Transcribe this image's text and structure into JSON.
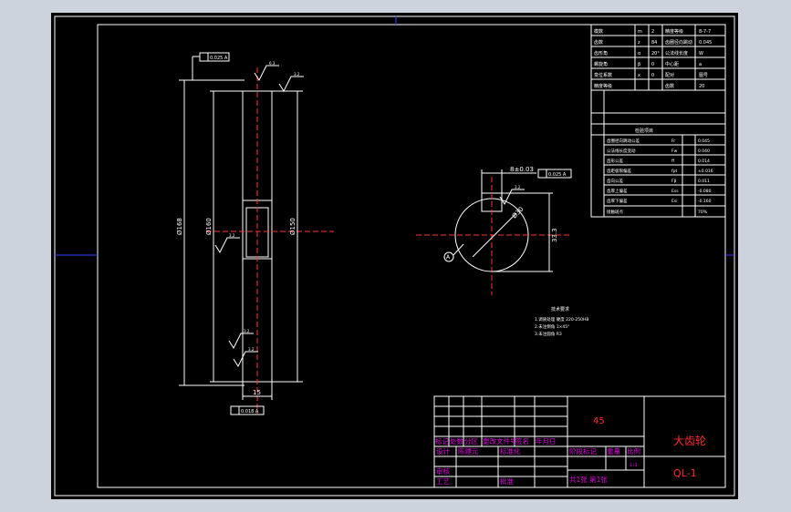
{
  "drawing": {
    "part_name": "大齿轮",
    "drawing_no": "QL-1",
    "material": "45",
    "scale": "1:1"
  },
  "front_view": {
    "dim_outer": "Ø168",
    "dim_middle": "Ø160",
    "dim_inner": "Ø150",
    "dim_width": "15",
    "tol_top": "0.025 A",
    "tol_bottom": "0.018 A",
    "rough_top": "6.3",
    "rough_2": "3.2",
    "rough_3": "3.2",
    "rough_4": "3.2",
    "rough_5": "3.2"
  },
  "side_view": {
    "dim_keyway": "8±0.03",
    "tol_keyway": "0.025 A",
    "dim_bore": "Ø30",
    "dim_depth": "33.3",
    "datum": "A",
    "rough_key": "3.2"
  },
  "params_table": {
    "rows": [
      [
        "模数",
        "m",
        "2",
        "精度等级",
        "8-7-7"
      ],
      [
        "齿数",
        "z",
        "84",
        "齿圈径向跳动",
        "0.045"
      ],
      [
        "齿形角",
        "α",
        "20°",
        "公法线长度",
        "W"
      ],
      [
        "螺旋角",
        "β",
        "0",
        "中心距",
        "a"
      ],
      [
        "变位系数",
        "x",
        "0",
        "配对",
        "图号"
      ],
      [
        "精度等级",
        "",
        "",
        "齿数",
        "20"
      ]
    ]
  },
  "inspection_table": {
    "header": "检验项目",
    "rows": [
      [
        "齿圈径向跳动公差",
        "Fr",
        "0.045"
      ],
      [
        "公法线长度变动",
        "Fw",
        "0.040"
      ],
      [
        "齿形公差",
        "ff",
        "0.014"
      ],
      [
        "齿距极限偏差",
        "fpt",
        "±0.016"
      ],
      [
        "齿向公差",
        "Fβ",
        "0.011"
      ],
      [
        "齿厚上偏差",
        "Ess",
        "-0.080"
      ],
      [
        "齿厚下偏差",
        "Esi",
        "-0.160"
      ],
      [
        "接触斑点",
        "",
        "70%"
      ]
    ]
  },
  "tech_requirements": {
    "title": "技术要求",
    "items": [
      "1.调质处理 硬度 220-250HB",
      "2.未注倒角 1×45°",
      "3.未注圆角 R3"
    ]
  },
  "title_block": {
    "row_labels_a": [
      "标记",
      "处数",
      "分区",
      "更改文件号",
      "签名",
      "年月日"
    ],
    "design": "设计",
    "design_name": "陈建元",
    "standardize": "标准化",
    "stage_labels": [
      "阶段标记",
      "重量",
      "比例"
    ],
    "audit": "审核",
    "process": "工艺",
    "approve": "批准",
    "sheets": "共1张 第1张"
  }
}
